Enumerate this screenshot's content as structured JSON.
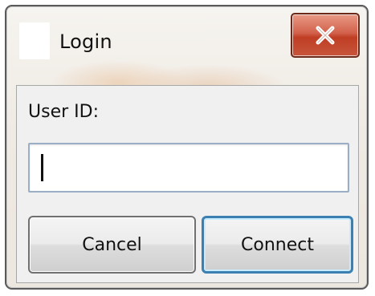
{
  "window": {
    "title": "Login",
    "close_glyph": "X",
    "close_icon": "close-icon"
  },
  "form": {
    "user_id_label": "User ID:",
    "user_id_value": ""
  },
  "buttons": {
    "cancel_label": "Cancel",
    "connect_label": "Connect"
  },
  "colors": {
    "close_button": "#c7553b",
    "default_button_border": "#3c7fb1",
    "input_border": "#9aaec6"
  }
}
